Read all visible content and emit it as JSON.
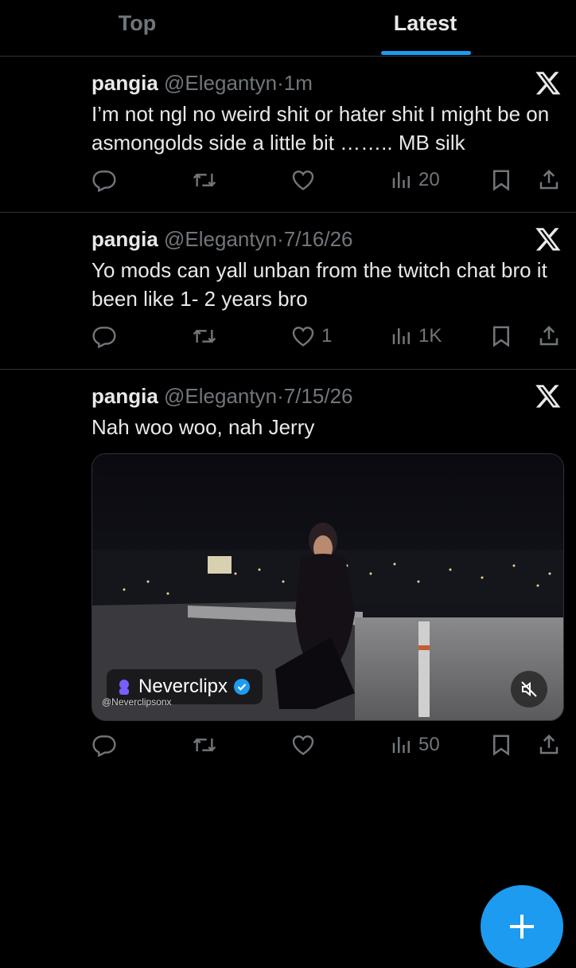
{
  "tabs": [
    {
      "label": "Top",
      "active": false
    },
    {
      "label": "Latest",
      "active": true
    }
  ],
  "accent_color": "#1d9bf0",
  "tweets": [
    {
      "name": "pangia",
      "handle": "@Elegantyn",
      "separator": "·",
      "time": "1m",
      "text": "I’m not ngl no weird shit or hater shit I might be on asmongolds side a little bit …….. MB silk",
      "replies": "",
      "retweets": "",
      "likes": "",
      "views": "20"
    },
    {
      "name": "pangia",
      "handle": "@Elegantyn",
      "separator": "·",
      "time": "7/16/26",
      "text": "Yo mods can yall unban from the twitch chat bro it been like 1- 2 years bro",
      "replies": "",
      "retweets": "",
      "likes": "1",
      "views": "1K"
    },
    {
      "name": "pangia",
      "handle": "@Elegantyn",
      "separator": "·",
      "time": "7/15/26",
      "text": "Nah woo woo, nah Jerry",
      "media": {
        "overlay_name": "Neverclipx",
        "overlay_handle": "@Neverclipsonx",
        "muted": true
      },
      "replies": "",
      "retweets": "",
      "likes": "",
      "views": "50"
    }
  ],
  "icons": {
    "platform": "x-logo-icon",
    "reply": "reply-icon",
    "retweet": "retweet-icon",
    "like": "heart-icon",
    "views": "views-bar-chart-icon",
    "bookmark": "bookmark-icon",
    "share": "share-icon",
    "compose": "plus-icon",
    "mute": "muted-speaker-icon",
    "verified": "verified-badge-icon"
  }
}
